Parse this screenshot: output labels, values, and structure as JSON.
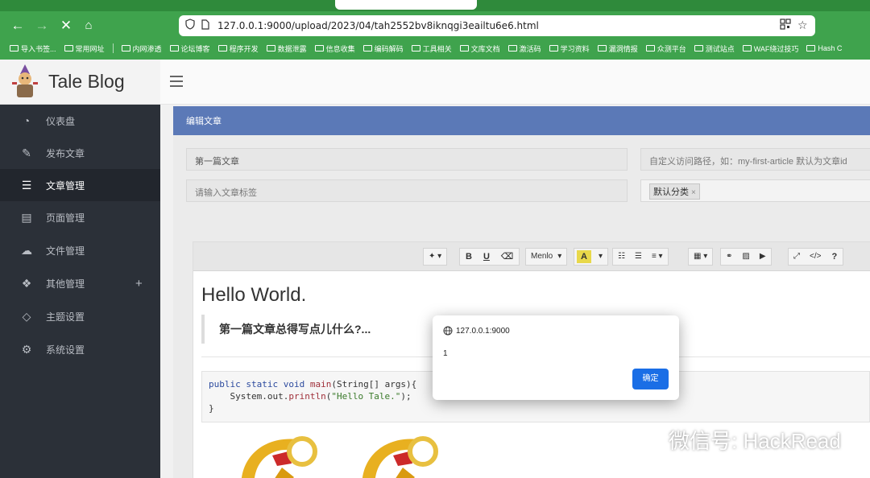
{
  "browser": {
    "url": "127.0.0.1:9000/upload/2023/04/tah2552bv8iknqgi3eailtu6e6.html",
    "bookmarks": [
      "导入书签...",
      "常用网址",
      "内网渗透",
      "论坛博客",
      "程序开发",
      "数据泄露",
      "信息收集",
      "编码解码",
      "工具相关",
      "文库文档",
      "激活码",
      "学习资料",
      "漏洞情报",
      "众测平台",
      "测试站点",
      "WAF绕过技巧",
      "Hash C"
    ]
  },
  "brand": {
    "title": "Tale Blog"
  },
  "sidebar": {
    "items": [
      {
        "label": "仪表盘",
        "icon": "dashboard-icon"
      },
      {
        "label": "发布文章",
        "icon": "edit-icon"
      },
      {
        "label": "文章管理",
        "icon": "list-icon"
      },
      {
        "label": "页面管理",
        "icon": "file-icon"
      },
      {
        "label": "文件管理",
        "icon": "cloud-upload-icon"
      },
      {
        "label": "其他管理",
        "icon": "cubes-icon"
      },
      {
        "label": "主题设置",
        "icon": "diamond-icon"
      },
      {
        "label": "系统设置",
        "icon": "gear-icon"
      }
    ],
    "plus": "+"
  },
  "panel": {
    "title": "编辑文章"
  },
  "form": {
    "title_value": "第一篇文章",
    "slug_placeholder": "自定义访问路径，如：my-first-article  默认为文章id",
    "tags_placeholder": "请输入文章标签",
    "category_tag": "默认分类",
    "category_remove": "×"
  },
  "toolbar": {
    "bold": "B",
    "underline": "U",
    "font": "Menlo",
    "color": "A",
    "help": "?",
    "code_view": "</>"
  },
  "editor": {
    "heading": "Hello World.",
    "quote": "第一篇文章总得写点儿什么?...",
    "code": {
      "line1_kw": "public static void ",
      "line1_fn": "main",
      "line1_rest": "(String[] args){",
      "line2_pre": "    System.out.",
      "line2_fn": "println",
      "line2_paren": "(",
      "line2_str": "\"Hello Tale.\"",
      "line2_end": ");",
      "line3": "}"
    }
  },
  "dialog": {
    "origin": "127.0.0.1:9000",
    "message": "1",
    "ok_label": "确定"
  },
  "watermark": {
    "text": "微信号: HackRead"
  },
  "colors": {
    "chrome": "#3fa34d",
    "sidebar": "#2b3038",
    "panel_header": "#5b79b7",
    "dialog_button": "#1a6ee6"
  }
}
